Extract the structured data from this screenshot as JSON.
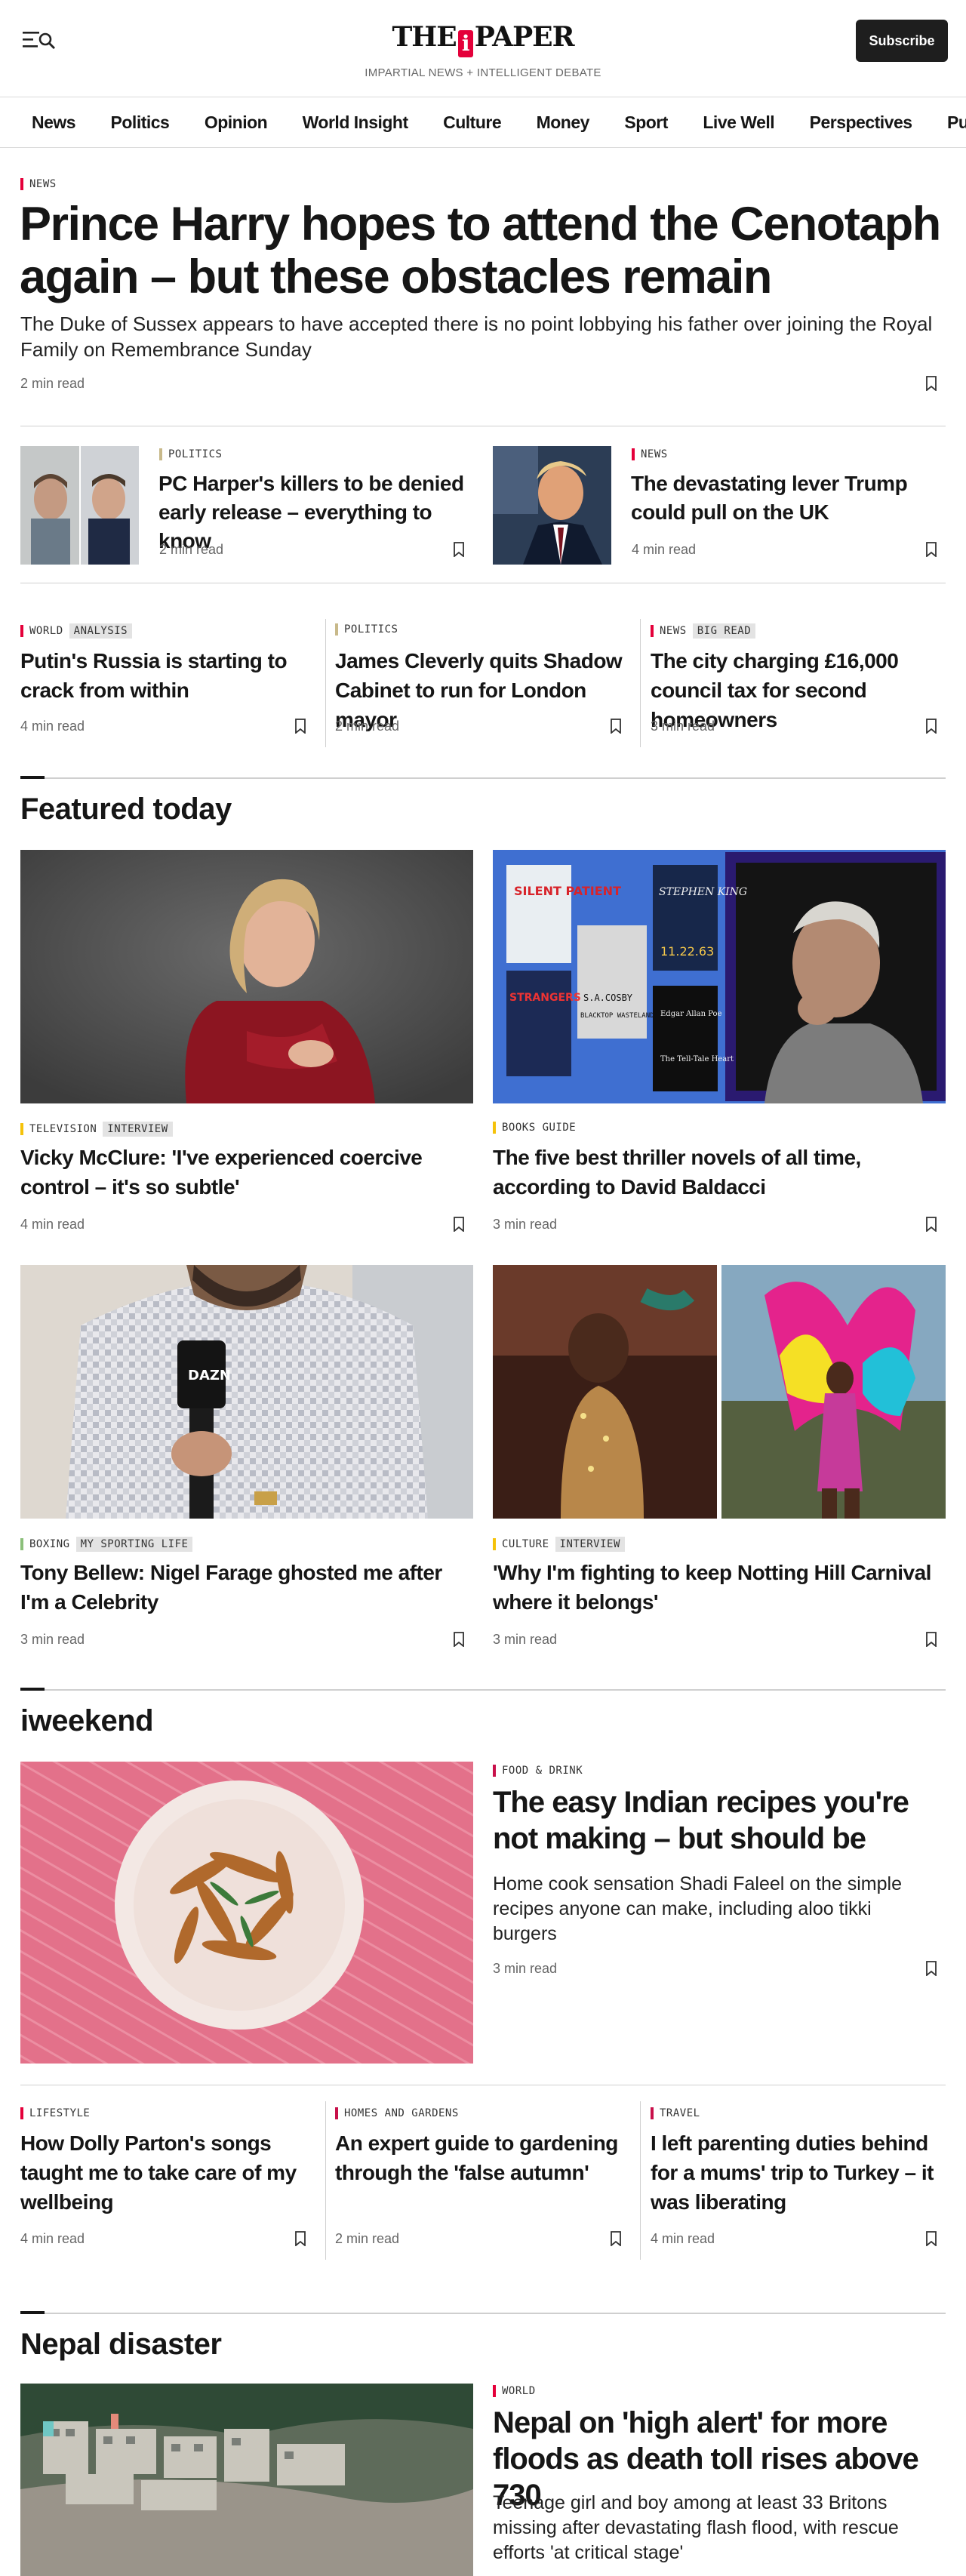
{
  "header": {
    "logo_left": "THE",
    "logo_mark": "i",
    "logo_right": "PAPER",
    "tagline": "IMPARTIAL NEWS + INTELLIGENT DEBATE",
    "subscribe_label": "Subscribe"
  },
  "nav": [
    "News",
    "Politics",
    "Opinion",
    "World Insight",
    "Culture",
    "Money",
    "Sport",
    "Live Well",
    "Perspectives",
    "Puzzles"
  ],
  "lead": {
    "kicker": "NEWS",
    "headline": "Prince Harry hopes to attend the Cenotaph again – but these obstacles remain",
    "standfirst": "The Duke of Sussex appears to have accepted there is no point lobbying his father over joining the Royal Family on Remembrance Sunday",
    "read_time": "2 min read"
  },
  "row2": [
    {
      "kicker": "POLITICS",
      "headline": "PC Harper's killers to be denied early release – everything to know",
      "read_time": "2 min read"
    },
    {
      "kicker": "NEWS",
      "headline": "The devastating lever Trump could pull on the UK",
      "read_time": "4 min read"
    }
  ],
  "row3": [
    {
      "kicker": "WORLD",
      "tag": "ANALYSIS",
      "headline": "Putin's Russia is starting to crack from within",
      "read_time": "4 min read"
    },
    {
      "kicker": "POLITICS",
      "tag": "",
      "headline": "James Cleverly quits Shadow Cabinet to run for London mayor",
      "read_time": "2 min read"
    },
    {
      "kicker": "NEWS",
      "tag": "BIG READ",
      "headline": "The city charging £16,000 council tax for second homeowners",
      "read_time": "3 min read"
    }
  ],
  "featured": {
    "title": "Featured today",
    "items": [
      {
        "kicker": "TELEVISION",
        "tag": "INTERVIEW",
        "headline": "Vicky McClure: 'I've experienced coercive control – it's so subtle'",
        "read_time": "4 min read"
      },
      {
        "kicker": "BOOKS GUIDE",
        "tag": "",
        "headline": "The five best thriller novels of all time, according to David Baldacci",
        "read_time": "3 min read"
      },
      {
        "kicker": "BOXING",
        "tag": "MY SPORTING LIFE",
        "headline": "Tony Bellew: Nigel Farage ghosted me after I'm a Celebrity",
        "read_time": "3 min read"
      },
      {
        "kicker": "CULTURE",
        "tag": "INTERVIEW",
        "headline": "'Why I'm fighting to keep Notting Hill Carnival where it belongs'",
        "read_time": "3 min read"
      }
    ],
    "book_covers": [
      "SILENT PATIENT",
      "STEPHEN KING",
      "11.22.63",
      "STRANGERS",
      "S.A.COSBY",
      "BLACKTOP WASTELAND",
      "Edgar Allan Poe",
      "The Tell-Tale Heart"
    ],
    "mic_brand": "DAZN"
  },
  "iweekend": {
    "title": "iweekend",
    "main": {
      "kicker": "FOOD & DRINK",
      "headline": "The easy Indian recipes you're not making – but should be",
      "standfirst": "Home cook sensation Shadi Faleel on the simple recipes anyone can make, including aloo tikki burgers",
      "read_time": "3 min read"
    },
    "row": [
      {
        "kicker": "LIFESTYLE",
        "headline": "How Dolly Parton's songs taught me to take care of my wellbeing",
        "read_time": "4 min read"
      },
      {
        "kicker": "HOMES AND GARDENS",
        "headline": "An expert guide to gardening through the 'false autumn'",
        "read_time": "2 min read"
      },
      {
        "kicker": "TRAVEL",
        "headline": "I left parenting duties behind for a mums' trip to Turkey – it was liberating",
        "read_time": "4 min read"
      }
    ]
  },
  "nepal": {
    "title": "Nepal disaster",
    "main": {
      "kicker": "WORLD",
      "headline": "Nepal on 'high alert' for more floods as death toll rises above 730",
      "standfirst": "Teenage girl and boy among at least 33 Britons missing after devastating flash flood, with rescue efforts 'at critical stage'"
    }
  },
  "colors": {
    "news": "#e4003a",
    "politics": "#c8b98a",
    "world": "#e4003a",
    "culture": "#f5c20a",
    "food": "#c8104a",
    "boxing": "#8bbf7a",
    "lifestyle": "#e4003a",
    "homes": "#c8104a",
    "travel": "#c8104a",
    "dark": "#1e1e1e"
  },
  "icons": [
    "menu-search-icon",
    "bookmark-icon"
  ]
}
